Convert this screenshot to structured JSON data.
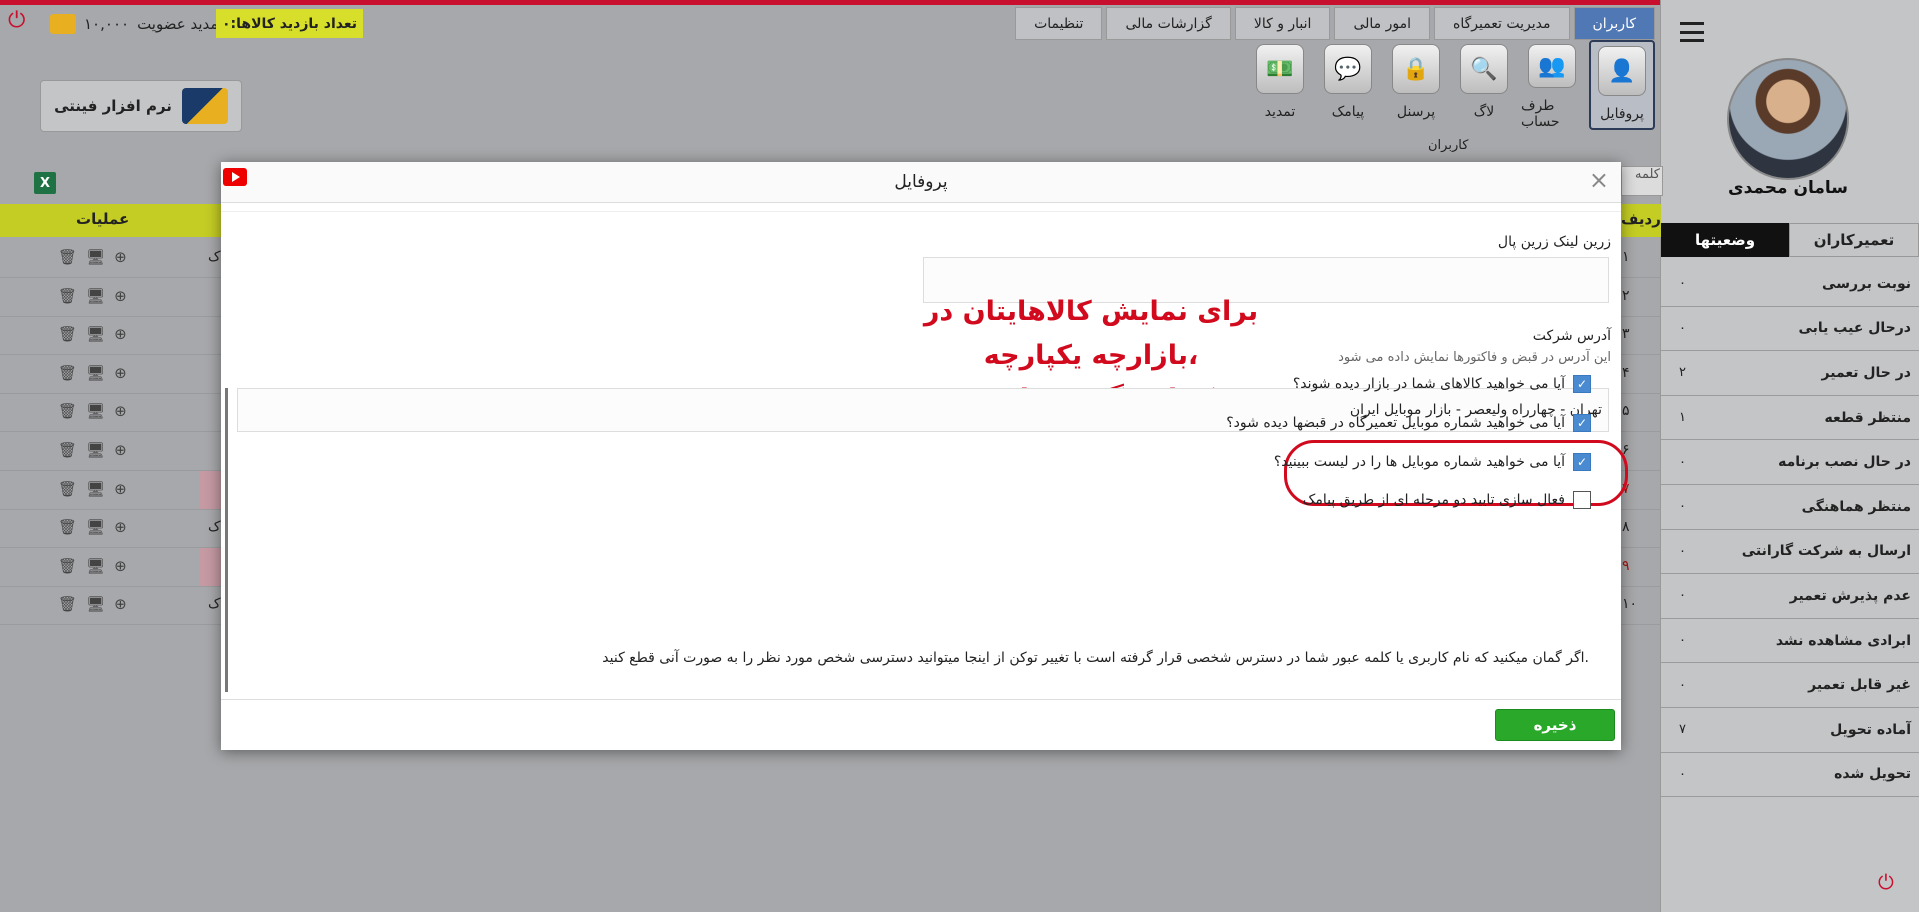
{
  "header": {
    "nav": [
      "کاربران",
      "مدیریت تعمیرگاه",
      "امور مالی",
      "انبار و کالا",
      "گزارشات مالی",
      "تنظیمات"
    ],
    "visit_label": "تعداد بازدید کالاها:۰",
    "renew_label": "تمدید عضویت",
    "renew_amount": "۱۰,۰۰۰",
    "logo_text": "نرم افزار فینتی"
  },
  "toolbar": {
    "items": [
      "پروفایل",
      "طرف حساب",
      "لاگ",
      "پرسنل",
      "پیامک",
      "تمدید"
    ],
    "caption": "کاربران"
  },
  "sidebar": {
    "user_name": "سامان محمدی",
    "tabs": [
      "تعمیرکاران",
      "وضعیتها"
    ],
    "statuses": [
      {
        "label": "نوبت بررسی",
        "count": "۰"
      },
      {
        "label": "درحال عیب یابی",
        "count": "۰"
      },
      {
        "label": "در حال تعمیر",
        "count": "۲"
      },
      {
        "label": "منتظر قطعه",
        "count": "۱"
      },
      {
        "label": "در حال نصب برنامه",
        "count": "۰"
      },
      {
        "label": "منتظر هماهنگی",
        "count": "۰"
      },
      {
        "label": "ارسال به شرکت گارانتی",
        "count": "۰"
      },
      {
        "label": "عدم پذیرش تعمیر",
        "count": "۰"
      },
      {
        "label": "ابرادی مشاهده نشد",
        "count": "۰"
      },
      {
        "label": "غیر قابل تعمیر",
        "count": "۰"
      },
      {
        "label": "آماده تحویل",
        "count": "۷"
      },
      {
        "label": "تحویل شده",
        "count": "۰"
      }
    ]
  },
  "table": {
    "search_stub": "کلمه",
    "columns": {
      "ops": "عملیات",
      "idx": "ردیف"
    },
    "rows": [
      "۱",
      "۲",
      "۳",
      "۴",
      "۵",
      "۶",
      "۷",
      "۸",
      "۹",
      "۱۰"
    ],
    "row_marker": "ک"
  },
  "modal": {
    "title": "پروفایل",
    "zarin_label": "زرین لینک زرین پال",
    "address_label": "آدرس شرکت",
    "address_hint": "این آدرس در قبض و فاکتورها نمایش داده می شود",
    "address_value": "تهران - چهارراه ولیعصر - بازار موبایل ایران",
    "annotation_line1": "برای نمایش کالاهایتان در بازارچه یکپارچه،",
    "annotation_line2": "تیک این گزینه را بزنید",
    "checks": [
      {
        "label": "آیا می خواهید کالاهای شما در بازار دیده شوند؟",
        "checked": true
      },
      {
        "label": "آیا می خواهید شماره موبایل تعمیرگاه در قبضها دیده شود؟",
        "checked": true
      },
      {
        "label": "آیا می خواهید شماره موبایل ها را در لیست ببینید؟",
        "checked": true
      },
      {
        "label": "فعال سازی تایید دو مرحله ای از طریق پیامک",
        "checked": false
      }
    ],
    "token_note": "اگر گمان میکنید که نام کاربری یا کلمه عبور شما در دسترس شخصی قرار گرفته است با تغییر توکن از اینجا میتوانید دسترسی شخص مورد نظر را به صورت آنی قطع کنید.",
    "save_label": "ذخیره"
  },
  "colors": {
    "accent": "#5078b4",
    "save": "#2aa82a",
    "annotation": "#d10a1e",
    "visit_badge": "#d7df2a"
  }
}
